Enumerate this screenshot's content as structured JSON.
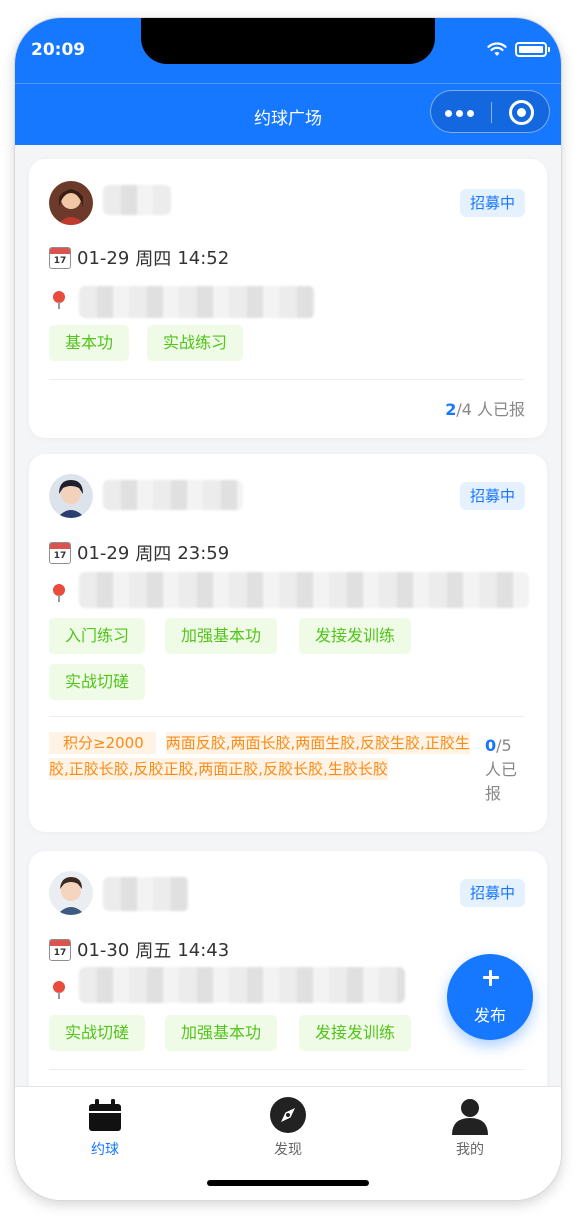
{
  "status_bar": {
    "time": "20:09"
  },
  "nav": {
    "title": "约球广场"
  },
  "posts": [
    {
      "date": "01-29",
      "weekday": "周四",
      "time": "14:52",
      "status": "招募中",
      "tags": [
        "基本功",
        "实战练习"
      ],
      "joined": "2",
      "capacity": "/4",
      "count_suffix": " 人已报"
    },
    {
      "date": "01-29",
      "weekday": "周四",
      "time": "23:59",
      "status": "招募中",
      "tags": [
        "入门练习",
        "加强基本功",
        "发接发训练",
        "实战切磋"
      ],
      "requirement_score": "积分≥2000",
      "requirement_rubber": "两面反胶,两面长胶,两面生胶,反胶生胶,正胶生胶,正胶长胶,反胶正胶,两面正胶,反胶长胶,生胶长胶",
      "joined": "0",
      "capacity": "/5",
      "count_suffix": "人已报"
    },
    {
      "date": "01-30",
      "weekday": "周五",
      "time": "14:43",
      "status": "招募中",
      "tags": [
        "实战切磋",
        "加强基本功",
        "发接发训练"
      ]
    }
  ],
  "fab": {
    "label": "发布"
  },
  "tabs": [
    {
      "label": "约球",
      "icon": "calendar-icon",
      "active": true
    },
    {
      "label": "发现",
      "icon": "compass-icon",
      "active": false
    },
    {
      "label": "我的",
      "icon": "user-icon",
      "active": false
    }
  ],
  "colors": {
    "primary": "#1677ff",
    "tag_green": "#52c41a",
    "tag_orange": "#fa8c16"
  }
}
